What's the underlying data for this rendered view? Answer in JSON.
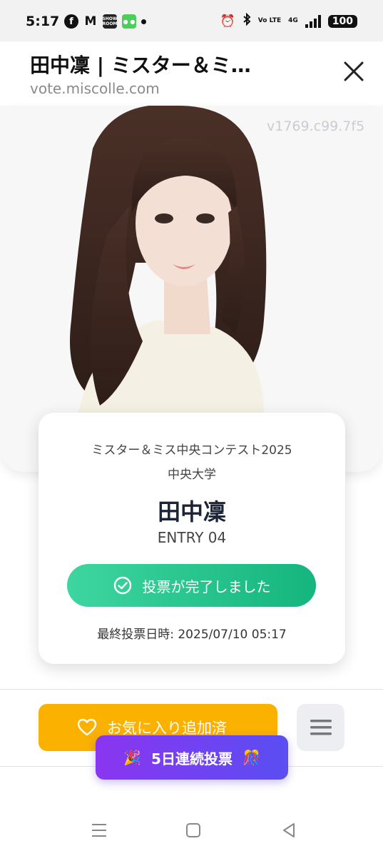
{
  "status_bar": {
    "time": "5:17",
    "left_icons": [
      "facebook-icon",
      "gmail-icon",
      "showroom-app-icon",
      "line-app-icon"
    ],
    "showroom_label": "SHOW ROOM",
    "volte_label": "Vo LTE",
    "network_label": "4G",
    "battery": "100"
  },
  "browser": {
    "title": "田中凜 | ミスター＆ミ…",
    "url": "vote.miscolle.com"
  },
  "hero": {
    "watermark": "v1769.c99.7f5",
    "accent_color": "#f7f7f7"
  },
  "entry": {
    "contest": "ミスター＆ミス中央コンテスト2025",
    "university": "中央大学",
    "name": "田中凜",
    "entry_no": "ENTRY 04",
    "vote_status": "投票が完了しました",
    "last_vote": "最終投票日時: 2025/07/10 05:17",
    "vote_color": "#1fc08a"
  },
  "actions": {
    "favorite_label": "お気に入り追加済",
    "favorite_color": "#fbb100",
    "streak_label": "5日連続投票",
    "streak_emoji_left": "🎉",
    "streak_emoji_right": "🎊",
    "streak_color": "#7a3ef0"
  }
}
